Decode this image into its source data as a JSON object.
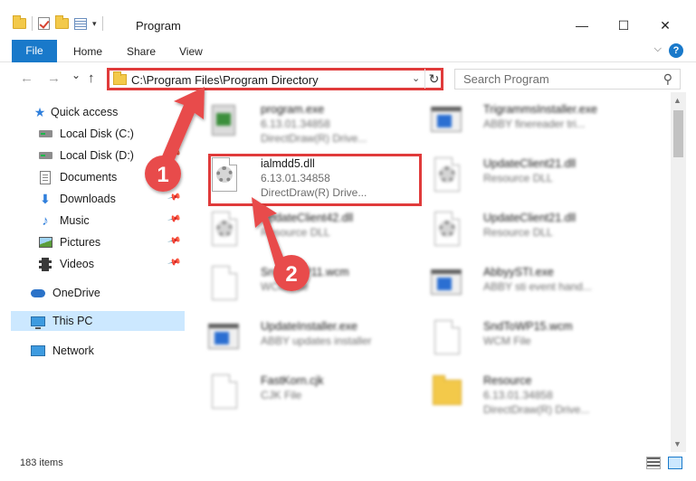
{
  "window": {
    "title": "Program",
    "minimize_glyph": "—",
    "maximize_glyph": "☐",
    "close_glyph": "✕"
  },
  "ribbon": {
    "tabs": [
      "File",
      "Home",
      "Share",
      "View"
    ],
    "expand_glyph": "⌵",
    "help_glyph": "?"
  },
  "nav": {
    "back_glyph": "←",
    "forward_glyph": "→",
    "recent_glyph": "⌄",
    "up_glyph": "↑",
    "address": "C:\\Program Files\\Program Directory",
    "dropdown_glyph": "⌄",
    "refresh_glyph": "↻"
  },
  "search": {
    "placeholder": "Search Program",
    "icon_glyph": "⚲"
  },
  "sidebar": {
    "quick_access": "Quick access",
    "items": [
      {
        "label": "Local Disk (C:)",
        "icon": "drive-icon"
      },
      {
        "label": "Local Disk (D:)",
        "icon": "drive-icon"
      },
      {
        "label": "Documents",
        "icon": "documents-icon"
      },
      {
        "label": "Downloads",
        "icon": "downloads-icon"
      },
      {
        "label": "Music",
        "icon": "music-icon"
      },
      {
        "label": "Pictures",
        "icon": "pictures-icon"
      },
      {
        "label": "Videos",
        "icon": "videos-icon"
      }
    ],
    "onedrive": "OneDrive",
    "this_pc": "This PC",
    "network": "Network"
  },
  "files": [
    {
      "name": "program.exe",
      "sub1": "6.13.01.34858",
      "sub2": "DirectDraw(R) Drive...",
      "icon": "exe-icon"
    },
    {
      "name": "TrigrammsInstaller.exe",
      "sub1": "ABBY finereader tri...",
      "sub2": "",
      "icon": "exe-icon"
    },
    {
      "name": "ialmdd5.dll",
      "sub1": "6.13.01.34858",
      "sub2": "DirectDraw(R) Drive...",
      "icon": "dll-icon"
    },
    {
      "name": "UpdateClient21.dll",
      "sub1": "Resource DLL",
      "sub2": "",
      "icon": "dll-icon"
    },
    {
      "name": "UpdateClient42.dll",
      "sub1": "Resource DLL",
      "sub2": "",
      "icon": "dll-icon"
    },
    {
      "name": "UpdateClient21.dll",
      "sub1": "Resource DLL",
      "sub2": "",
      "icon": "dll-icon"
    },
    {
      "name": "SndToWP11.wcm",
      "sub1": "WCM File",
      "sub2": "",
      "icon": "file-icon"
    },
    {
      "name": "AbbyySTI.exe",
      "sub1": "ABBY sti event hand...",
      "sub2": "",
      "icon": "exe-icon"
    },
    {
      "name": "UpdateInstaller.exe",
      "sub1": "ABBY updates installer",
      "sub2": "",
      "icon": "exe-icon"
    },
    {
      "name": "SndToWP15.wcm",
      "sub1": "WCM File",
      "sub2": "",
      "icon": "file-icon"
    },
    {
      "name": "FastKorn.cjk",
      "sub1": "CJK File",
      "sub2": "",
      "icon": "file-icon"
    },
    {
      "name": "Resource",
      "sub1": "6.13.01.34858",
      "sub2": "DirectDraw(R) Drive...",
      "icon": "folder-icon"
    }
  ],
  "callouts": [
    "1",
    "2"
  ],
  "scrollbar": {
    "up_glyph": "▲",
    "down_glyph": "▼"
  },
  "status": {
    "items": "183 items"
  },
  "colors": {
    "accent": "#1979ca",
    "highlight": "#e03b3b",
    "selected": "#cce8ff"
  }
}
